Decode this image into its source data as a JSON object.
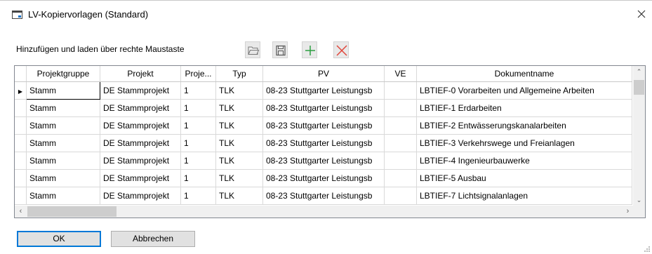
{
  "window": {
    "title": "LV-Kopiervorlagen (Standard)"
  },
  "hint": "Hinzufügen und laden über rechte Maustaste",
  "toolbar": {
    "buttons": [
      {
        "name": "open",
        "icon": "folder-open-icon"
      },
      {
        "name": "save",
        "icon": "save-icon"
      },
      {
        "name": "add",
        "icon": "plus-icon",
        "color": "#2ea043"
      },
      {
        "name": "delete",
        "icon": "delete-x-icon",
        "color": "#e0453a"
      }
    ]
  },
  "grid": {
    "columns": [
      "Projektgruppe",
      "Projekt",
      "Proje...",
      "Typ",
      "PV",
      "VE",
      "Dokumentname"
    ],
    "rows": [
      [
        "Stamm",
        "DE Stammprojekt",
        "1",
        "TLK",
        "08-23 Stuttgarter Leistungsb",
        "",
        "LBTIEF-0 Vorarbeiten und Allgemeine Arbeiten"
      ],
      [
        "Stamm",
        "DE Stammprojekt",
        "1",
        "TLK",
        "08-23 Stuttgarter Leistungsb",
        "",
        "LBTIEF-1 Erdarbeiten"
      ],
      [
        "Stamm",
        "DE Stammprojekt",
        "1",
        "TLK",
        "08-23 Stuttgarter Leistungsb",
        "",
        "LBTIEF-2 Entwässerungskanalarbeiten"
      ],
      [
        "Stamm",
        "DE Stammprojekt",
        "1",
        "TLK",
        "08-23 Stuttgarter Leistungsb",
        "",
        "LBTIEF-3 Verkehrswege und Freianlagen"
      ],
      [
        "Stamm",
        "DE Stammprojekt",
        "1",
        "TLK",
        "08-23 Stuttgarter Leistungsb",
        "",
        "LBTIEF-4 Ingenieurbauwerke"
      ],
      [
        "Stamm",
        "DE Stammprojekt",
        "1",
        "TLK",
        "08-23 Stuttgarter Leistungsb",
        "",
        "LBTIEF-5 Ausbau"
      ],
      [
        "Stamm",
        "DE Stammprojekt",
        "1",
        "TLK",
        "08-23 Stuttgarter Leistungsb",
        "",
        "LBTIEF-7 Lichtsignalanlagen"
      ]
    ],
    "current_row": 0
  },
  "buttons": {
    "ok": "OK",
    "cancel": "Abbrechen"
  }
}
